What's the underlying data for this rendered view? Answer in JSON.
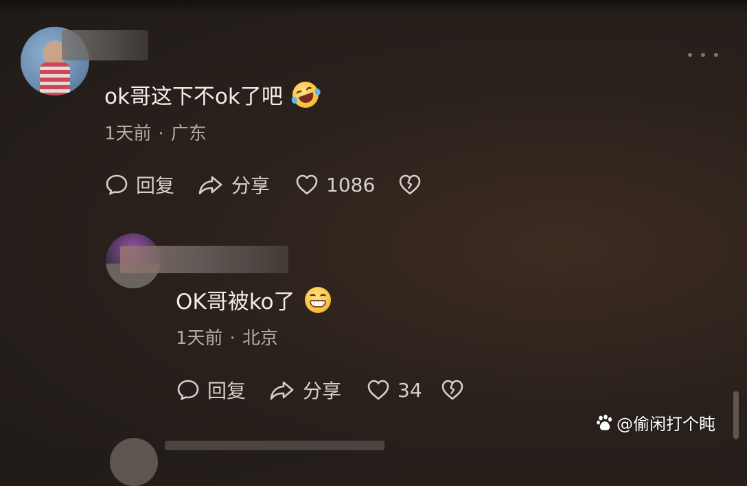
{
  "comments": [
    {
      "text": "ok哥这下不ok了吧",
      "emoji_icon": "rolling-on-floor-laughing-icon",
      "time": "1天前",
      "separator": "·",
      "location": "广东",
      "reply_label": "回复",
      "share_label": "分享",
      "like_count": "1086"
    },
    {
      "text": "OK哥被ko了",
      "emoji_icon": "grinning-face-icon",
      "time": "1天前",
      "separator": "·",
      "location": "北京",
      "reply_label": "回复",
      "share_label": "分享",
      "like_count": "34"
    }
  ],
  "watermark": {
    "text": "@偷闲打个盹",
    "icon": "paw-logo-icon"
  },
  "colors": {
    "background": "#2a211c",
    "text_primary": "#f2eeea",
    "text_secondary": "#b3aba5",
    "icon": "#d7d1cc"
  }
}
